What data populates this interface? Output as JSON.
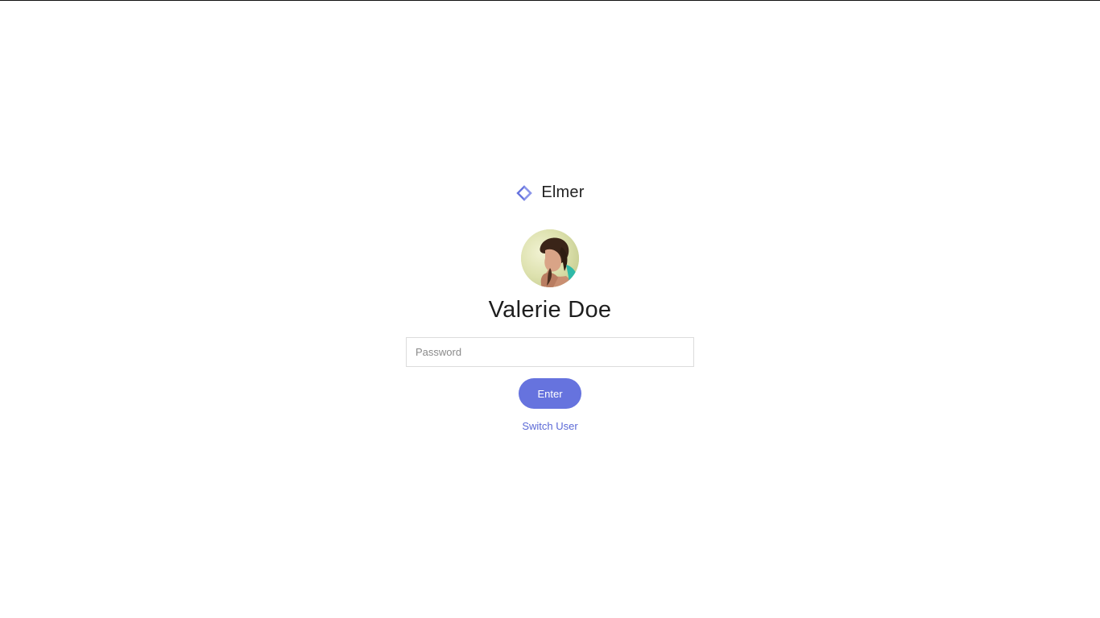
{
  "brand": {
    "name": "Elmer",
    "icon": "diamond-logo-icon",
    "accent_color": "#6673de"
  },
  "user": {
    "name": "Valerie Doe",
    "avatar": "user-avatar-photo"
  },
  "password": {
    "placeholder": "Password",
    "value": ""
  },
  "actions": {
    "enter_label": "Enter",
    "switch_user_label": "Switch User"
  }
}
